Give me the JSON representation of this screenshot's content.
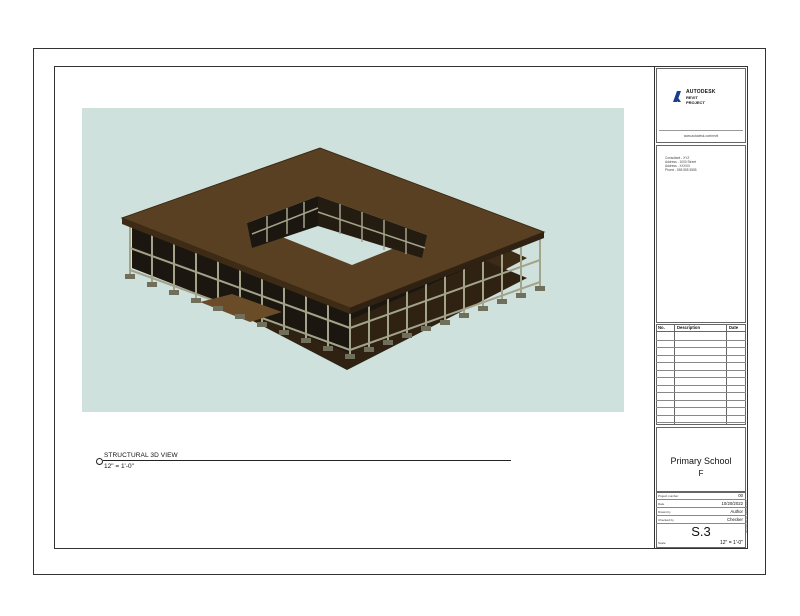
{
  "view": {
    "title": "STRUCTURAL 3D VIEW",
    "scale": "12\" = 1'-0\""
  },
  "titleblock": {
    "logo": {
      "brand": "AUTODESK",
      "line2": "REVIT",
      "line3": "PROJECT",
      "url": "www.autodesk.com/revit"
    },
    "consultants": [
      "Consultant - XYZ",
      "Address - 1000 Street",
      "Address - XXXXX",
      "Phone - 555 555 5555"
    ],
    "revisions": {
      "col_no": "No.",
      "col_desc": "Description",
      "col_date": "Date",
      "row_count": 12
    },
    "project": {
      "name": "Primary School",
      "sub": "F"
    },
    "info": [
      {
        "label": "Project number",
        "value": "00"
      },
      {
        "label": "Date",
        "value": "10/20/2022"
      },
      {
        "label": "Drawn by",
        "value": "Author"
      },
      {
        "label": "Checked by",
        "value": "Checker"
      }
    ],
    "sheet_number": "S.3",
    "scale_label": "Scale",
    "scale_value": "12\" = 1'-0\"",
    "side_date": "10/20/2022 10:00:00 PM"
  },
  "colors": {
    "viewport_bg": "#cfe1dd",
    "slab_top": "#5a4022",
    "slab_side": "#3d2b16",
    "frame": "#9a9a82",
    "column": "#7a7a66"
  }
}
